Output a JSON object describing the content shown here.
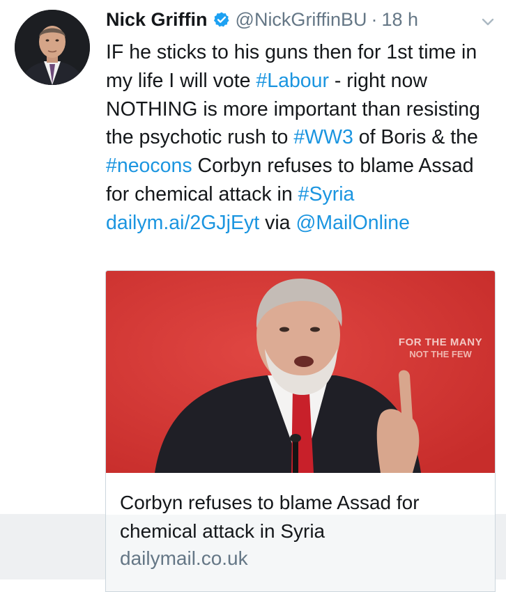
{
  "tweet": {
    "author": {
      "name": "Nick Griffin",
      "handle": "@NickGriffinBU",
      "verified": true,
      "avatar_icon": "user-avatar"
    },
    "separator": "·",
    "time": "18 h",
    "menu_icon": "chevron-down-icon",
    "text": {
      "p1": "IF he sticks to his guns then for 1st time in my life I will vote ",
      "h_labour": "#Labour",
      "p2": " - right now NOTHING is more important than resisting the psychotic rush to ",
      "h_ww3": "#WW3",
      "p3": " of Boris & the ",
      "h_neocons": "#neocons",
      "p4": " Corbyn refuses to blame Assad for chemical attack in ",
      "h_syria": "#Syria",
      "sp": " ",
      "url": "dailym.ai/2GJjEyt",
      "p5": " via ",
      "mention": "@MailOnline"
    },
    "card": {
      "image_icon": "article-photo",
      "sign_line1": "FOR THE MANY",
      "sign_line2": "NOT THE FEW",
      "title": "Corbyn refuses to blame Assad for chemical attack in Syria",
      "domain": "dailymail.co.uk"
    }
  },
  "colors": {
    "link": "#1b95e0",
    "text": "#14171a",
    "secondary": "#657786",
    "verified": "#1da1f2",
    "card_image_bg": "#d63533",
    "border": "#ccd6dd"
  }
}
